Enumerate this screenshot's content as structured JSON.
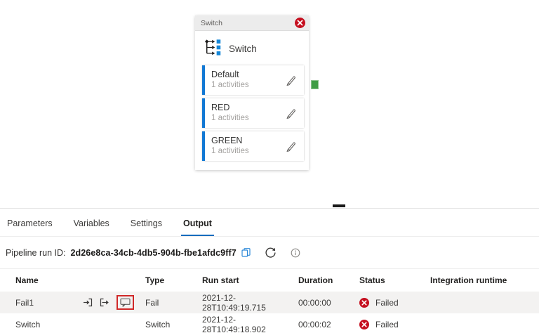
{
  "switch_card": {
    "header_title": "Switch",
    "body_title": "Switch",
    "cases": [
      {
        "name": "Default",
        "subtitle": "1 activities"
      },
      {
        "name": "RED",
        "subtitle": "1 activities"
      },
      {
        "name": "GREEN",
        "subtitle": "1 activities"
      }
    ]
  },
  "output_panel": {
    "tabs": [
      {
        "label": "Parameters"
      },
      {
        "label": "Variables"
      },
      {
        "label": "Settings"
      },
      {
        "label": "Output"
      }
    ],
    "active_tab": "Output",
    "run_id_label": "Pipeline run ID:",
    "run_id_value": "2d26e8ca-34cb-4db5-904b-fbe1afdc9ff7",
    "table": {
      "columns": [
        "Name",
        "Type",
        "Run start",
        "Duration",
        "Status",
        "Integration runtime"
      ],
      "rows": [
        {
          "name": "Fail1",
          "type": "Fail",
          "run_start": "2021-12-28T10:49:19.715",
          "duration": "00:00:00",
          "status": "Failed",
          "integration_runtime": ""
        },
        {
          "name": "Switch",
          "type": "Switch",
          "run_start": "2021-12-28T10:49:18.902",
          "duration": "00:00:02",
          "status": "Failed",
          "integration_runtime": ""
        }
      ]
    }
  },
  "icons": {
    "close": "close-icon (white x in red circle)",
    "switch": "switch-branch-icon (black tree with blue squares)",
    "edit": "pencil-icon",
    "copy": "copy-icon (blue)",
    "refresh": "refresh-icon",
    "info": "info-icon",
    "input": "input-arrow-icon",
    "output": "output-arrow-icon",
    "comment": "comment-bubble-icon (highlighted with red box)",
    "failed": "error-x-icon (white x in red circle)"
  },
  "colors": {
    "accent_blue": "#0f6cbd",
    "case_bar_blue": "#1178d4",
    "icon_square_blue": "#1587d8",
    "failed_red": "#c50f1f",
    "annotation_highlight_red": "#d02828",
    "connector_green": "#3f9c45",
    "alt_row_gray": "#f3f2f1"
  }
}
